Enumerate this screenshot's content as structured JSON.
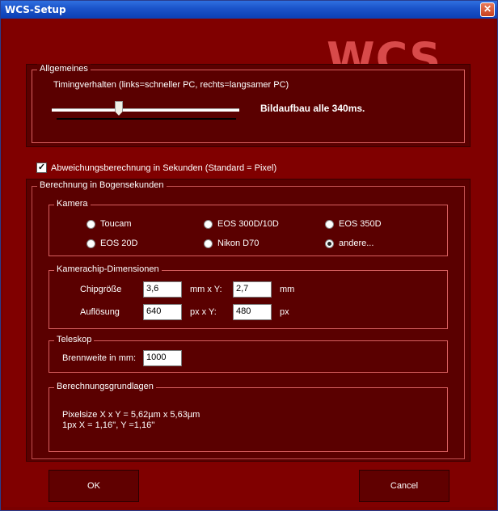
{
  "window": {
    "title": "WCS-Setup",
    "close_icon": "✕"
  },
  "logo": {
    "text": "WCS"
  },
  "general": {
    "label": "Allgemeines",
    "timing_label": "Timingverhalten (links=schneller PC, rechts=langsamer PC)",
    "slider_level_fraction": 0.35,
    "build_text": "Bildaufbau alle 340ms."
  },
  "deviation": {
    "checked": true,
    "check_mark": "✓",
    "label": "Abweichungsberechnung in Sekunden (Standard = Pixel)"
  },
  "arcsec": {
    "label": "Berechnung in Bogensekunden",
    "camera": {
      "label": "Kamera",
      "options": [
        {
          "label": "Toucam",
          "selected": false
        },
        {
          "label": "EOS 300D/10D",
          "selected": false
        },
        {
          "label": "EOS 350D",
          "selected": false
        },
        {
          "label": "EOS 20D",
          "selected": false
        },
        {
          "label": "Nikon D70",
          "selected": false
        },
        {
          "label": "andere...",
          "selected": true
        }
      ]
    },
    "chip": {
      "label": "Kamerachip-Dimensionen",
      "size_label": "Chipgröße",
      "size_x": "3,6",
      "size_unit_x": "mm  x  Y:",
      "size_y": "2,7",
      "size_unit_y": "mm",
      "res_label": "Auflösung",
      "res_x": "640",
      "res_unit_x": "px  x  Y:",
      "res_y": "480",
      "res_unit_y": "px"
    },
    "telescope": {
      "label": "Teleskop",
      "focal_label": "Brennweite in mm:",
      "focal_value": "1000"
    },
    "basis": {
      "label": "Berechnungsgrundlagen",
      "line1": "Pixelsize X x Y = 5,62µm x 5,63µm",
      "line2": "1px X = 1,16'', Y =1,16''"
    }
  },
  "buttons": {
    "ok": "OK",
    "cancel": "Cancel"
  }
}
